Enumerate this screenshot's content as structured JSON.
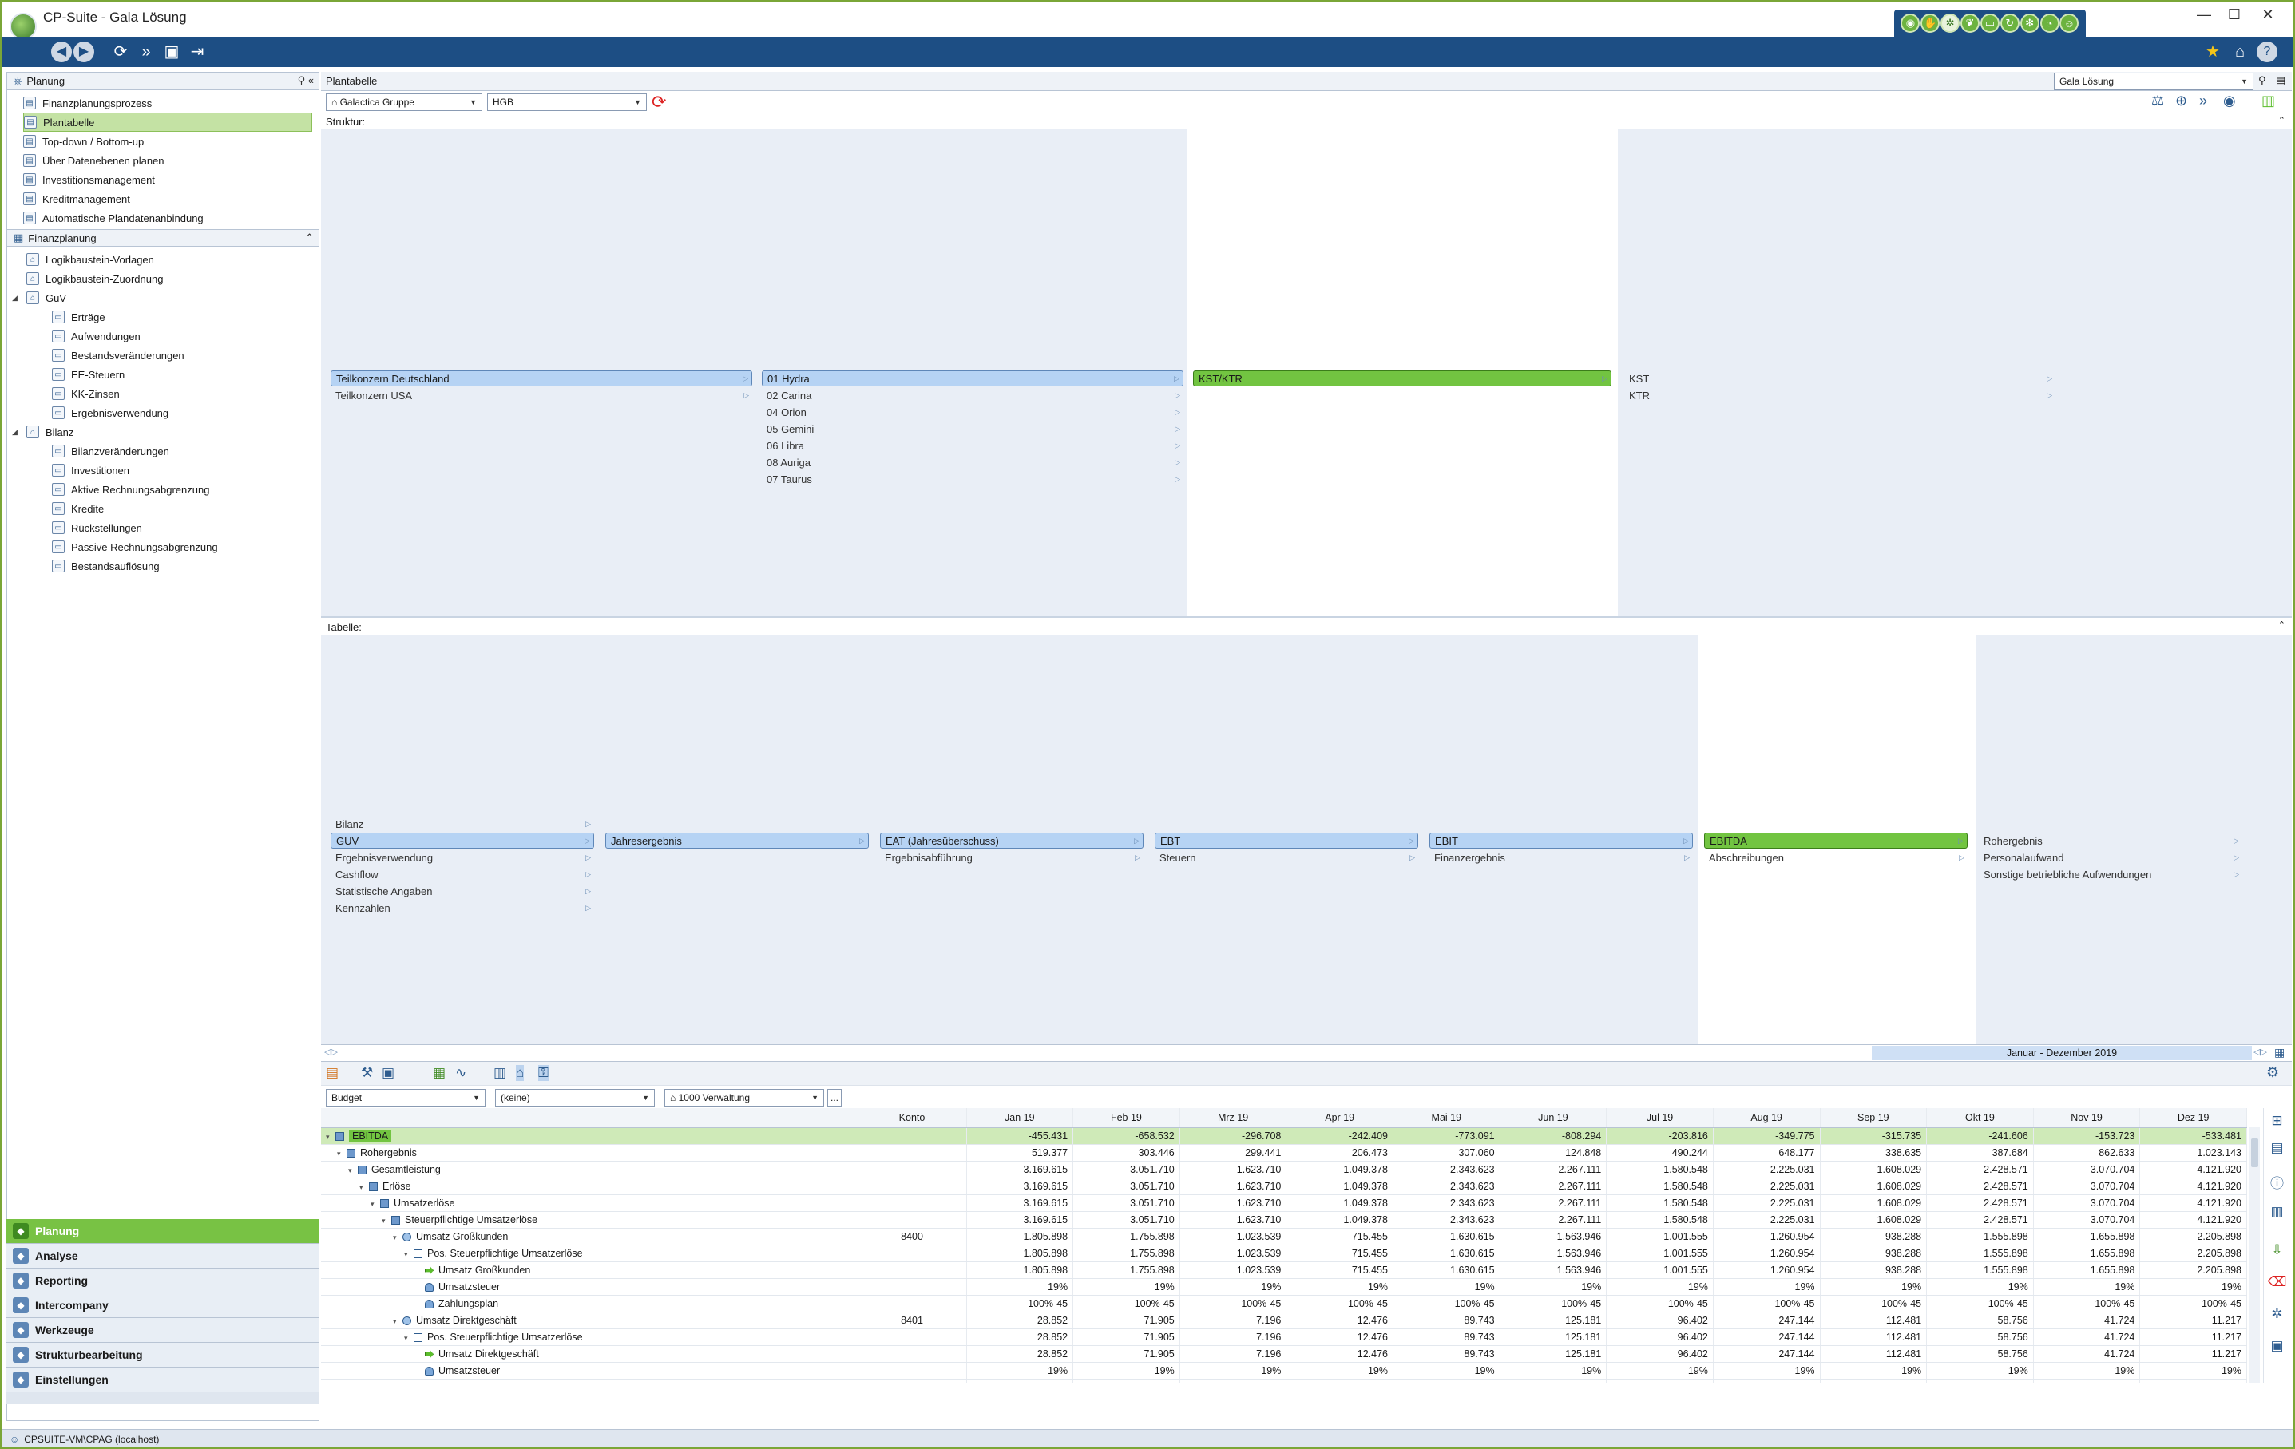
{
  "window": {
    "title": "CP-Suite - Gala Lösung",
    "minimize": "—",
    "maximize": "☐",
    "close": "✕"
  },
  "toolbar_icons": [
    "back-icon",
    "forward-icon",
    "refresh-icon",
    "fast-forward-icon",
    "window-icon",
    "export-icon"
  ],
  "module_icons": [
    "globe-icon",
    "hand-icon",
    "network-icon",
    "leaf-icon",
    "money-icon",
    "cycle-icon",
    "gear-icon",
    "compass-icon",
    "people-icon"
  ],
  "toolbar_right": {
    "star": "★",
    "home": "⌂",
    "help": "?"
  },
  "left": {
    "planung_header": "Planung",
    "planung_items": [
      {
        "label": "Finanzplanungsprozess",
        "selected": false
      },
      {
        "label": "Plantabelle",
        "selected": true
      },
      {
        "label": "Top-down / Bottom-up",
        "selected": false
      },
      {
        "label": "Über Datenebenen planen",
        "selected": false
      },
      {
        "label": "Investitionsmanagement",
        "selected": false
      },
      {
        "label": "Kreditmanagement",
        "selected": false
      },
      {
        "label": "Automatische Plandatenanbindung",
        "selected": false
      }
    ],
    "finanz_header": "Finanzplanung",
    "finanz_items": [
      {
        "label": "Logikbaustein-Vorlagen",
        "level": 0,
        "caret": ""
      },
      {
        "label": "Logikbaustein-Zuordnung",
        "level": 0,
        "caret": ""
      },
      {
        "label": "GuV",
        "level": 0,
        "caret": "◢"
      },
      {
        "label": "Erträge",
        "level": 1,
        "caret": ""
      },
      {
        "label": "Aufwendungen",
        "level": 1,
        "caret": ""
      },
      {
        "label": "Bestandsveränderungen",
        "level": 1,
        "caret": ""
      },
      {
        "label": "EE-Steuern",
        "level": 1,
        "caret": ""
      },
      {
        "label": "KK-Zinsen",
        "level": 1,
        "caret": ""
      },
      {
        "label": "Ergebnisverwendung",
        "level": 1,
        "caret": ""
      },
      {
        "label": "Bilanz",
        "level": 0,
        "caret": "◢"
      },
      {
        "label": "Bilanzveränderungen",
        "level": 1,
        "caret": ""
      },
      {
        "label": "Investitionen",
        "level": 1,
        "caret": ""
      },
      {
        "label": "Aktive Rechnungsabgrenzung",
        "level": 1,
        "caret": ""
      },
      {
        "label": "Kredite",
        "level": 1,
        "caret": ""
      },
      {
        "label": "Rückstellungen",
        "level": 1,
        "caret": ""
      },
      {
        "label": "Passive Rechnungsabgrenzung",
        "level": 1,
        "caret": ""
      },
      {
        "label": "Bestandsauflösung",
        "level": 1,
        "caret": ""
      }
    ],
    "big_menu": [
      {
        "label": "Planung",
        "selected": true
      },
      {
        "label": "Analyse",
        "selected": false
      },
      {
        "label": "Reporting",
        "selected": false
      },
      {
        "label": "Intercompany",
        "selected": false
      },
      {
        "label": "Werkzeuge",
        "selected": false
      },
      {
        "label": "Strukturbearbeitung",
        "selected": false
      },
      {
        "label": "Einstellungen",
        "selected": false
      }
    ]
  },
  "main": {
    "header": "Plantabelle",
    "solution_select": "Gala Lösung",
    "group_select": "Galactica Gruppe",
    "standard_select": "HGB",
    "struktur_label": "Struktur:",
    "tabelle_label": "Tabelle:",
    "struktur": {
      "col1": [
        {
          "label": "Teilkonzern Deutschland",
          "style": "bar"
        },
        {
          "label": "Teilkonzern USA",
          "style": "plain"
        }
      ],
      "col2": [
        {
          "label": "01 Hydra",
          "style": "bar"
        },
        {
          "label": "02 Carina",
          "style": "plain"
        },
        {
          "label": "04 Orion",
          "style": "plain"
        },
        {
          "label": "05 Gemini",
          "style": "plain"
        },
        {
          "label": "06 Libra",
          "style": "plain"
        },
        {
          "label": "08 Auriga",
          "style": "plain"
        },
        {
          "label": "07 Taurus",
          "style": "plain"
        }
      ],
      "col3": [
        {
          "label": "KST/KTR",
          "style": "green"
        }
      ],
      "col4": [
        {
          "label": "KST",
          "style": "plain"
        },
        {
          "label": "KTR",
          "style": "plain"
        }
      ]
    },
    "tabelle": {
      "col1": [
        {
          "label": "Bilanz",
          "style": "plain"
        },
        {
          "label": "GUV",
          "style": "bar"
        },
        {
          "label": "Ergebnisverwendung",
          "style": "plain"
        },
        {
          "label": "Cashflow",
          "style": "plain"
        },
        {
          "label": "Statistische Angaben",
          "style": "plain"
        },
        {
          "label": "Kennzahlen",
          "style": "plain"
        }
      ],
      "col2": [
        {
          "label": "Jahresergebnis",
          "style": "bar"
        }
      ],
      "col3": [
        {
          "label": "EAT (Jahresüberschuss)",
          "style": "bar"
        },
        {
          "label": "Ergebnisabführung",
          "style": "plain"
        }
      ],
      "col4": [
        {
          "label": "EBT",
          "style": "bar"
        },
        {
          "label": "Steuern",
          "style": "plain"
        }
      ],
      "col5": [
        {
          "label": "EBIT",
          "style": "bar"
        },
        {
          "label": "Finanzergebnis",
          "style": "plain"
        }
      ],
      "col6": [
        {
          "label": "EBITDA",
          "style": "green"
        },
        {
          "label": "Abschreibungen",
          "style": "plain"
        }
      ],
      "col7": [
        {
          "label": "Rohergebnis",
          "style": "plain"
        },
        {
          "label": "Personalaufwand",
          "style": "plain"
        },
        {
          "label": "Sonstige betriebliche Aufwendungen",
          "style": "plain"
        }
      ]
    },
    "timeline_label": "Januar - Dezember 2019",
    "grid_filters": {
      "scenario": "Budget",
      "dimension": "(keine)",
      "cost_center": "1000 Verwaltung",
      "more": "..."
    },
    "grid": {
      "konto_header": "Konto",
      "months": [
        "Jan 19",
        "Feb 19",
        "Mrz 19",
        "Apr 19",
        "Mai 19",
        "Jun 19",
        "Jul 19",
        "Aug 19",
        "Sep 19",
        "Okt 19",
        "Nov 19",
        "Dez 19"
      ],
      "rows": [
        {
          "label": "EBITDA",
          "level": 0,
          "icon": "square",
          "caret": "▾",
          "konto": "",
          "hl": true,
          "values": [
            "-455.431",
            "-658.532",
            "-296.708",
            "-242.409",
            "-773.091",
            "-808.294",
            "-203.816",
            "-349.775",
            "-315.735",
            "-241.606",
            "-153.723",
            "-533.481"
          ]
        },
        {
          "label": "Rohergebnis",
          "level": 1,
          "icon": "square",
          "caret": "▾",
          "konto": "",
          "hl": false,
          "values": [
            "519.377",
            "303.446",
            "299.441",
            "206.473",
            "307.060",
            "124.848",
            "490.244",
            "648.177",
            "338.635",
            "387.684",
            "862.633",
            "1.023.143"
          ]
        },
        {
          "label": "Gesamtleistung",
          "level": 2,
          "icon": "square",
          "caret": "▾",
          "konto": "",
          "hl": false,
          "values": [
            "3.169.615",
            "3.051.710",
            "1.623.710",
            "1.049.378",
            "2.343.623",
            "2.267.111",
            "1.580.548",
            "2.225.031",
            "1.608.029",
            "2.428.571",
            "3.070.704",
            "4.121.920"
          ]
        },
        {
          "label": "Erlöse",
          "level": 3,
          "icon": "square",
          "caret": "▾",
          "konto": "",
          "hl": false,
          "values": [
            "3.169.615",
            "3.051.710",
            "1.623.710",
            "1.049.378",
            "2.343.623",
            "2.267.111",
            "1.580.548",
            "2.225.031",
            "1.608.029",
            "2.428.571",
            "3.070.704",
            "4.121.920"
          ]
        },
        {
          "label": "Umsatzerlöse",
          "level": 4,
          "icon": "square",
          "caret": "▾",
          "konto": "",
          "hl": false,
          "values": [
            "3.169.615",
            "3.051.710",
            "1.623.710",
            "1.049.378",
            "2.343.623",
            "2.267.111",
            "1.580.548",
            "2.225.031",
            "1.608.029",
            "2.428.571",
            "3.070.704",
            "4.121.920"
          ]
        },
        {
          "label": "Steuerpflichtige Umsatzerlöse",
          "level": 5,
          "icon": "square",
          "caret": "▾",
          "konto": "",
          "hl": false,
          "values": [
            "3.169.615",
            "3.051.710",
            "1.623.710",
            "1.049.378",
            "2.343.623",
            "2.267.111",
            "1.580.548",
            "2.225.031",
            "1.608.029",
            "2.428.571",
            "3.070.704",
            "4.121.920"
          ]
        },
        {
          "label": "Umsatz Großkunden",
          "level": 6,
          "icon": "gear",
          "caret": "▾",
          "konto": "8400",
          "hl": false,
          "values": [
            "1.805.898",
            "1.755.898",
            "1.023.539",
            "715.455",
            "1.630.615",
            "1.563.946",
            "1.001.555",
            "1.260.954",
            "938.288",
            "1.555.898",
            "1.655.898",
            "2.205.898"
          ]
        },
        {
          "label": "Pos. Steuerpflichtige Umsatzerlöse",
          "level": 7,
          "icon": "plus",
          "caret": "▾",
          "konto": "",
          "hl": false,
          "values": [
            "1.805.898",
            "1.755.898",
            "1.023.539",
            "715.455",
            "1.630.615",
            "1.563.946",
            "1.001.555",
            "1.260.954",
            "938.288",
            "1.555.898",
            "1.655.898",
            "2.205.898"
          ]
        },
        {
          "label": "Umsatz Großkunden",
          "level": 8,
          "icon": "green",
          "caret": "",
          "konto": "",
          "hl": false,
          "values": [
            "1.805.898",
            "1.755.898",
            "1.023.539",
            "715.455",
            "1.630.615",
            "1.563.946",
            "1.001.555",
            "1.260.954",
            "938.288",
            "1.555.898",
            "1.655.898",
            "2.205.898"
          ]
        },
        {
          "label": "Umsatzsteuer",
          "level": 8,
          "icon": "person",
          "caret": "",
          "konto": "",
          "hl": false,
          "values": [
            "19%",
            "19%",
            "19%",
            "19%",
            "19%",
            "19%",
            "19%",
            "19%",
            "19%",
            "19%",
            "19%",
            "19%"
          ]
        },
        {
          "label": "Zahlungsplan",
          "level": 8,
          "icon": "person",
          "caret": "",
          "konto": "",
          "hl": false,
          "values": [
            "100%-45",
            "100%-45",
            "100%-45",
            "100%-45",
            "100%-45",
            "100%-45",
            "100%-45",
            "100%-45",
            "100%-45",
            "100%-45",
            "100%-45",
            "100%-45"
          ]
        },
        {
          "label": "Umsatz Direktgeschäft",
          "level": 6,
          "icon": "gear",
          "caret": "▾",
          "konto": "8401",
          "hl": false,
          "values": [
            "28.852",
            "71.905",
            "7.196",
            "12.476",
            "89.743",
            "125.181",
            "96.402",
            "247.144",
            "112.481",
            "58.756",
            "41.724",
            "11.217"
          ]
        },
        {
          "label": "Pos. Steuerpflichtige Umsatzerlöse",
          "level": 7,
          "icon": "plus",
          "caret": "▾",
          "konto": "",
          "hl": false,
          "values": [
            "28.852",
            "71.905",
            "7.196",
            "12.476",
            "89.743",
            "125.181",
            "96.402",
            "247.144",
            "112.481",
            "58.756",
            "41.724",
            "11.217"
          ]
        },
        {
          "label": "Umsatz Direktgeschäft",
          "level": 8,
          "icon": "green",
          "caret": "",
          "konto": "",
          "hl": false,
          "values": [
            "28.852",
            "71.905",
            "7.196",
            "12.476",
            "89.743",
            "125.181",
            "96.402",
            "247.144",
            "112.481",
            "58.756",
            "41.724",
            "11.217"
          ]
        },
        {
          "label": "Umsatzsteuer",
          "level": 8,
          "icon": "person",
          "caret": "",
          "konto": "",
          "hl": false,
          "values": [
            "19%",
            "19%",
            "19%",
            "19%",
            "19%",
            "19%",
            "19%",
            "19%",
            "19%",
            "19%",
            "19%",
            "19%"
          ]
        },
        {
          "label": "Zahlungsplan",
          "level": 8,
          "icon": "person",
          "caret": "",
          "konto": "",
          "hl": false,
          "values": [
            "100%-45",
            "100%-45",
            "100%-45",
            "100%-45",
            "100%-45",
            "100%-45",
            "100%-45",
            "100%-45",
            "100%-45",
            "100%-45",
            "100%-45",
            "100%-45"
          ]
        }
      ]
    }
  },
  "status": {
    "text": "CPSUITE-VM\\CPAG (localhost)"
  },
  "colors": {
    "accent": "#1d4e84",
    "green": "#72c441",
    "node_blue": "#b6d3f4",
    "panel_bg": "#e9eef6"
  }
}
